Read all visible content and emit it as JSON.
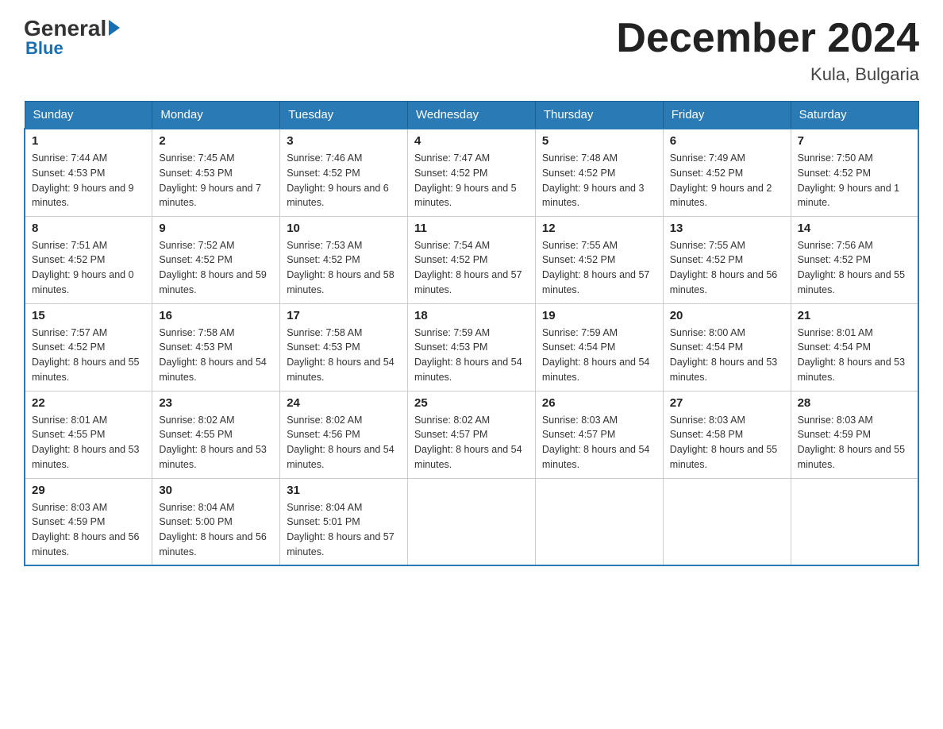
{
  "header": {
    "logo_general": "General",
    "logo_blue": "Blue",
    "month_title": "December 2024",
    "location": "Kula, Bulgaria"
  },
  "days_of_week": [
    "Sunday",
    "Monday",
    "Tuesday",
    "Wednesday",
    "Thursday",
    "Friday",
    "Saturday"
  ],
  "weeks": [
    [
      {
        "num": "1",
        "sunrise": "7:44 AM",
        "sunset": "4:53 PM",
        "daylight": "9 hours and 9 minutes."
      },
      {
        "num": "2",
        "sunrise": "7:45 AM",
        "sunset": "4:53 PM",
        "daylight": "9 hours and 7 minutes."
      },
      {
        "num": "3",
        "sunrise": "7:46 AM",
        "sunset": "4:52 PM",
        "daylight": "9 hours and 6 minutes."
      },
      {
        "num": "4",
        "sunrise": "7:47 AM",
        "sunset": "4:52 PM",
        "daylight": "9 hours and 5 minutes."
      },
      {
        "num": "5",
        "sunrise": "7:48 AM",
        "sunset": "4:52 PM",
        "daylight": "9 hours and 3 minutes."
      },
      {
        "num": "6",
        "sunrise": "7:49 AM",
        "sunset": "4:52 PM",
        "daylight": "9 hours and 2 minutes."
      },
      {
        "num": "7",
        "sunrise": "7:50 AM",
        "sunset": "4:52 PM",
        "daylight": "9 hours and 1 minute."
      }
    ],
    [
      {
        "num": "8",
        "sunrise": "7:51 AM",
        "sunset": "4:52 PM",
        "daylight": "9 hours and 0 minutes."
      },
      {
        "num": "9",
        "sunrise": "7:52 AM",
        "sunset": "4:52 PM",
        "daylight": "8 hours and 59 minutes."
      },
      {
        "num": "10",
        "sunrise": "7:53 AM",
        "sunset": "4:52 PM",
        "daylight": "8 hours and 58 minutes."
      },
      {
        "num": "11",
        "sunrise": "7:54 AM",
        "sunset": "4:52 PM",
        "daylight": "8 hours and 57 minutes."
      },
      {
        "num": "12",
        "sunrise": "7:55 AM",
        "sunset": "4:52 PM",
        "daylight": "8 hours and 57 minutes."
      },
      {
        "num": "13",
        "sunrise": "7:55 AM",
        "sunset": "4:52 PM",
        "daylight": "8 hours and 56 minutes."
      },
      {
        "num": "14",
        "sunrise": "7:56 AM",
        "sunset": "4:52 PM",
        "daylight": "8 hours and 55 minutes."
      }
    ],
    [
      {
        "num": "15",
        "sunrise": "7:57 AM",
        "sunset": "4:52 PM",
        "daylight": "8 hours and 55 minutes."
      },
      {
        "num": "16",
        "sunrise": "7:58 AM",
        "sunset": "4:53 PM",
        "daylight": "8 hours and 54 minutes."
      },
      {
        "num": "17",
        "sunrise": "7:58 AM",
        "sunset": "4:53 PM",
        "daylight": "8 hours and 54 minutes."
      },
      {
        "num": "18",
        "sunrise": "7:59 AM",
        "sunset": "4:53 PM",
        "daylight": "8 hours and 54 minutes."
      },
      {
        "num": "19",
        "sunrise": "7:59 AM",
        "sunset": "4:54 PM",
        "daylight": "8 hours and 54 minutes."
      },
      {
        "num": "20",
        "sunrise": "8:00 AM",
        "sunset": "4:54 PM",
        "daylight": "8 hours and 53 minutes."
      },
      {
        "num": "21",
        "sunrise": "8:01 AM",
        "sunset": "4:54 PM",
        "daylight": "8 hours and 53 minutes."
      }
    ],
    [
      {
        "num": "22",
        "sunrise": "8:01 AM",
        "sunset": "4:55 PM",
        "daylight": "8 hours and 53 minutes."
      },
      {
        "num": "23",
        "sunrise": "8:02 AM",
        "sunset": "4:55 PM",
        "daylight": "8 hours and 53 minutes."
      },
      {
        "num": "24",
        "sunrise": "8:02 AM",
        "sunset": "4:56 PM",
        "daylight": "8 hours and 54 minutes."
      },
      {
        "num": "25",
        "sunrise": "8:02 AM",
        "sunset": "4:57 PM",
        "daylight": "8 hours and 54 minutes."
      },
      {
        "num": "26",
        "sunrise": "8:03 AM",
        "sunset": "4:57 PM",
        "daylight": "8 hours and 54 minutes."
      },
      {
        "num": "27",
        "sunrise": "8:03 AM",
        "sunset": "4:58 PM",
        "daylight": "8 hours and 55 minutes."
      },
      {
        "num": "28",
        "sunrise": "8:03 AM",
        "sunset": "4:59 PM",
        "daylight": "8 hours and 55 minutes."
      }
    ],
    [
      {
        "num": "29",
        "sunrise": "8:03 AM",
        "sunset": "4:59 PM",
        "daylight": "8 hours and 56 minutes."
      },
      {
        "num": "30",
        "sunrise": "8:04 AM",
        "sunset": "5:00 PM",
        "daylight": "8 hours and 56 minutes."
      },
      {
        "num": "31",
        "sunrise": "8:04 AM",
        "sunset": "5:01 PM",
        "daylight": "8 hours and 57 minutes."
      },
      null,
      null,
      null,
      null
    ]
  ],
  "labels": {
    "sunrise": "Sunrise:",
    "sunset": "Sunset:",
    "daylight": "Daylight:"
  }
}
